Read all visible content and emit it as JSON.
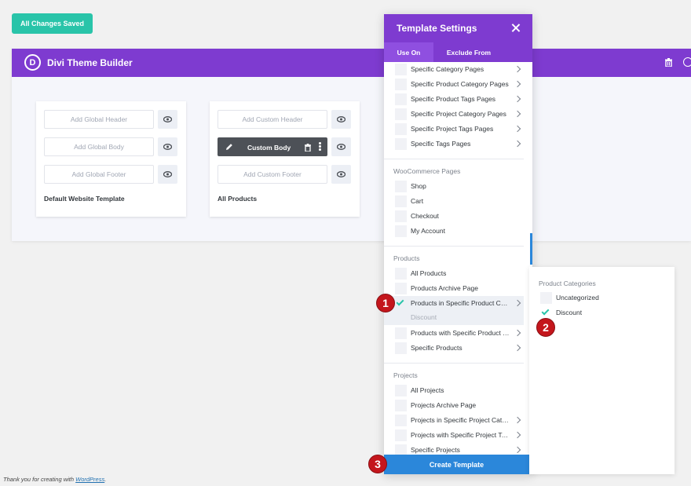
{
  "top": {
    "saved_label": "All Changes Saved"
  },
  "builder": {
    "logo_letter": "D",
    "title": "Divi Theme Builder",
    "default_card": {
      "header": "Add Global Header",
      "body": "Add Global Body",
      "footer": "Add Global Footer",
      "name": "Default Website Template"
    },
    "products_card": {
      "header": "Add Custom Header",
      "body": "Custom Body",
      "footer": "Add Custom Footer",
      "name": "All Products"
    }
  },
  "modal": {
    "title": "Template Settings",
    "tabs": [
      "Use On",
      "Exclude From"
    ],
    "archive_items": [
      "Specific Category Pages",
      "Specific Product Category Pages",
      "Specific Product Tags Pages",
      "Specific Project Category Pages",
      "Specific Project Tags Pages",
      "Specific Tags Pages"
    ],
    "woocommerce": {
      "label": "WooCommerce Pages",
      "items": [
        "Shop",
        "Cart",
        "Checkout",
        "My Account"
      ]
    },
    "products": {
      "label": "Products",
      "items": [
        "All Products",
        "Products Archive Page",
        "Products in Specific Product Categories",
        "Products with Specific Product Tags",
        "Specific Products"
      ],
      "selected_sub": "Discount"
    },
    "projects": {
      "label": "Projects",
      "items": [
        "All Projects",
        "Projects Archive Page",
        "Projects in Specific Project Categories",
        "Projects with Specific Project Tags",
        "Specific Projects"
      ]
    },
    "create_label": "Create Template"
  },
  "subpanel": {
    "title": "Product Categories",
    "items": [
      "Uncategorized",
      "Discount"
    ]
  },
  "badges": [
    "1",
    "2",
    "3"
  ],
  "footer": {
    "prefix": "Thank you for creating with ",
    "link": "WordPress",
    "suffix": "."
  },
  "colors": {
    "purple": "#7e3bd0",
    "teal": "#29c4a9",
    "blue": "#2b87da",
    "badge_red": "#c4161c"
  }
}
